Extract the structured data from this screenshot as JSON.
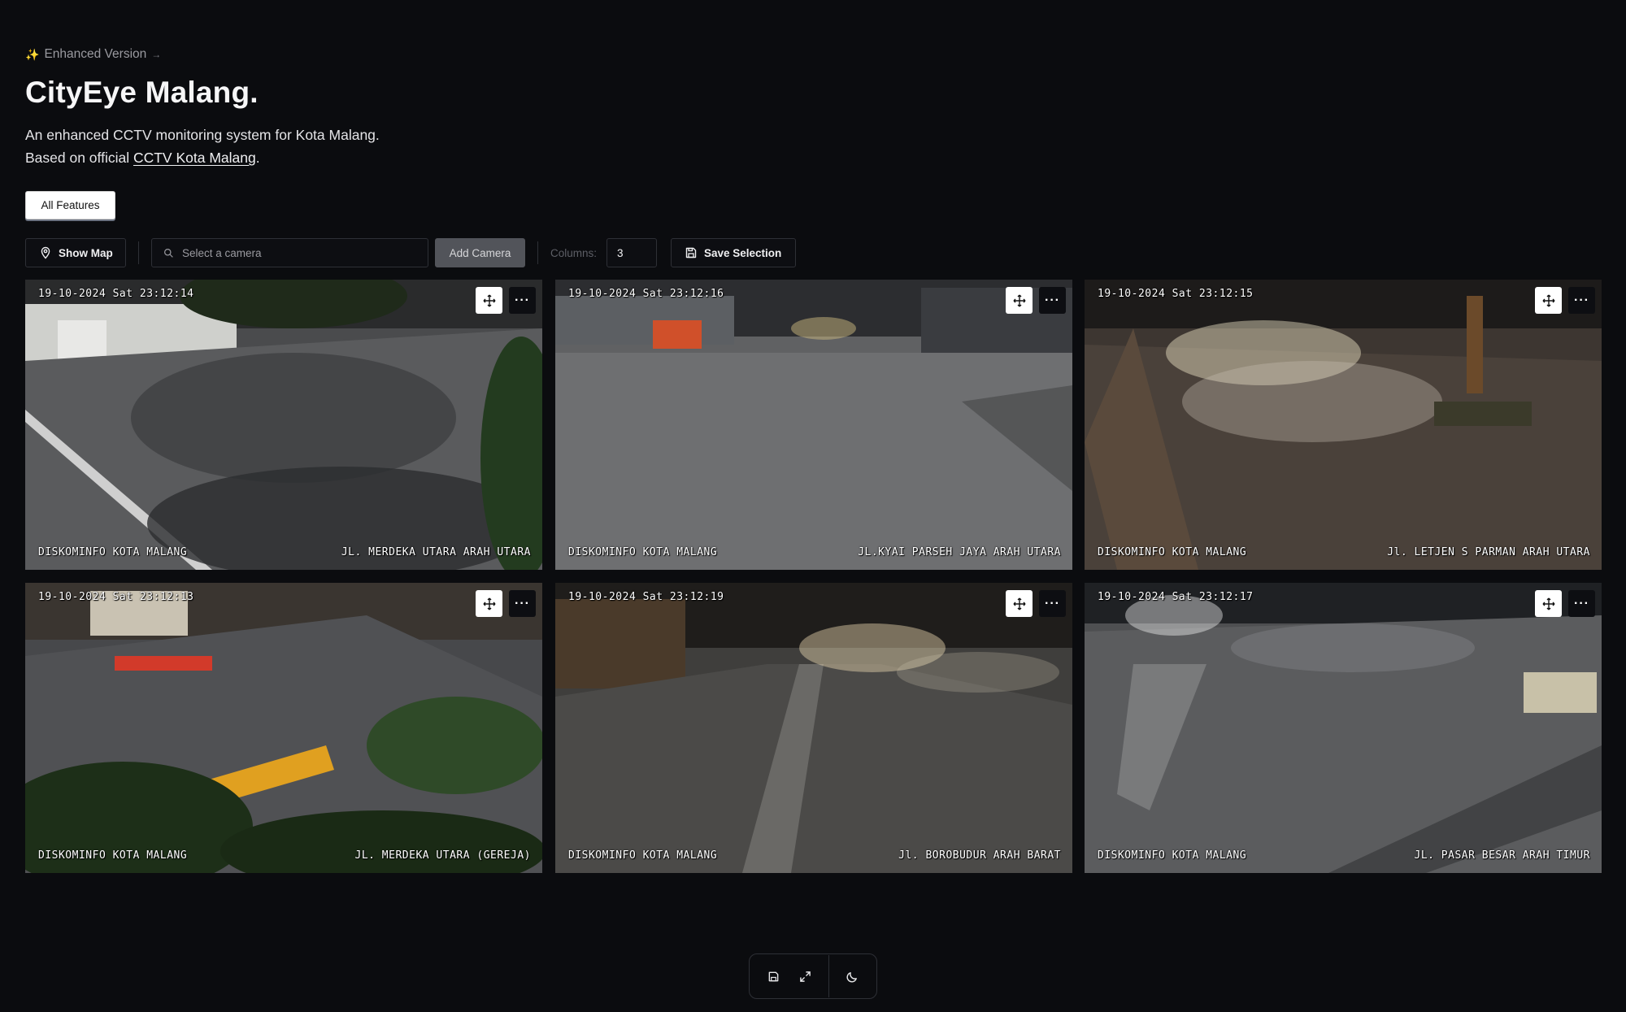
{
  "header": {
    "version_sparkle": "✨",
    "version_label": "Enhanced Version",
    "version_arrow": "→",
    "title": "CityEye Malang.",
    "description_line1": "An enhanced CCTV monitoring system for Kota Malang.",
    "description_line2_prefix": "Based on official ",
    "description_link": "CCTV Kota Malang",
    "description_line2_suffix": ".",
    "features_button": "All Features"
  },
  "toolbar": {
    "show_map": "Show Map",
    "search_placeholder": "Select a camera",
    "add_camera": "Add Camera",
    "columns_label": "Columns:",
    "columns_value": "3",
    "save_selection": "Save Selection"
  },
  "cameras": [
    {
      "timestamp": "19-10-2024 Sat 23:12:14",
      "source": "DISKOMINFO KOTA MALANG",
      "location": "JL. MERDEKA UTARA ARAH UTARA",
      "more": "···"
    },
    {
      "timestamp": "19-10-2024 Sat 23:12:16",
      "source": "DISKOMINFO KOTA MALANG",
      "location": "JL.KYAI PARSEH JAYA ARAH UTARA",
      "more": "···"
    },
    {
      "timestamp": "19-10-2024 Sat 23:12:15",
      "source": "DISKOMINFO KOTA MALANG",
      "location": "Jl. LETJEN S PARMAN ARAH UTARA",
      "more": "···"
    },
    {
      "timestamp": "19-10-2024 Sat 23:12:13",
      "source": "DISKOMINFO KOTA MALANG",
      "location": "JL. MERDEKA UTARA (GEREJA)",
      "more": "···"
    },
    {
      "timestamp": "19-10-2024 Sat 23:12:19",
      "source": "DISKOMINFO KOTA MALANG",
      "location": "Jl. BOROBUDUR ARAH BARAT",
      "more": "···"
    },
    {
      "timestamp": "19-10-2024 Sat 23:12:17",
      "source": "DISKOMINFO KOTA MALANG",
      "location": "JL. PASAR BESAR ARAH TIMUR",
      "more": "···"
    }
  ],
  "bottom_bar": {
    "icons": [
      "save-icon",
      "expand-icon",
      "moon-icon"
    ]
  },
  "colors": {
    "background": "#0b0c0f",
    "border": "#2e3036",
    "add_camera_bg": "#52545a"
  }
}
